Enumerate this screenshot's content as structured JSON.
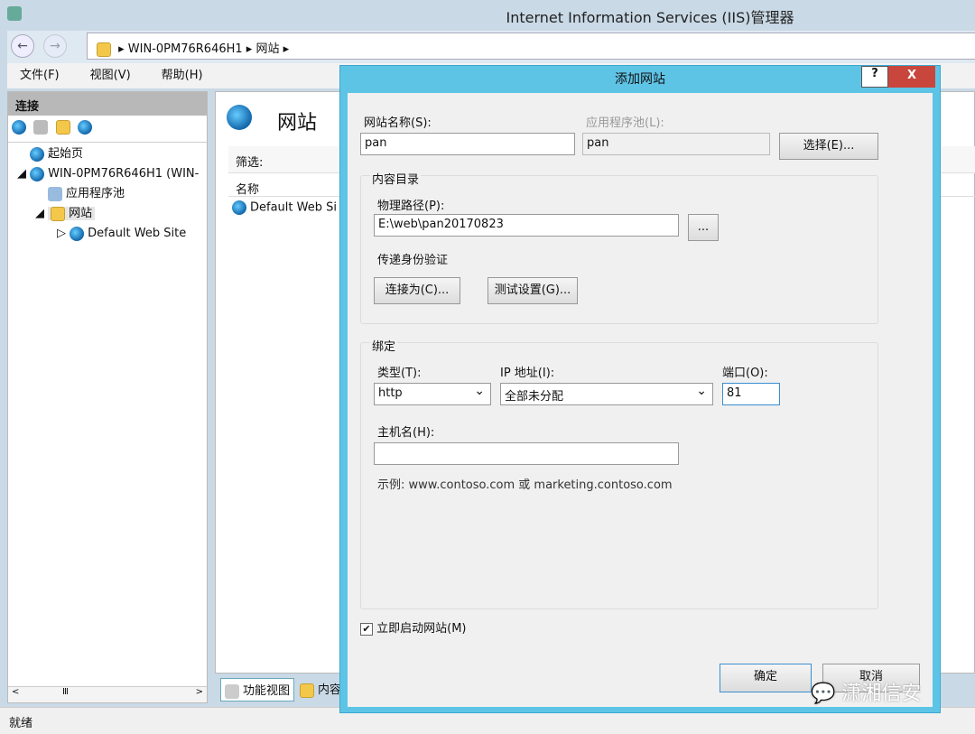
{
  "window": {
    "title": "Internet Information Services (IIS)管理器"
  },
  "address": {
    "crumbs": [
      "WIN-0PM76R646H1",
      "网站"
    ]
  },
  "menu": [
    "文件(F)",
    "视图(V)",
    "帮助(H)"
  ],
  "connections": {
    "header": "连接",
    "tree": [
      "起始页",
      "WIN-0PM76R646H1 (WIN-",
      "应用程序池",
      "网站",
      "Default Web Site"
    ]
  },
  "main": {
    "title": "网站",
    "filter_label": "筛选:",
    "column_name": "名称",
    "rows": [
      "Default Web Si"
    ],
    "tabs": [
      "功能视图",
      "内容"
    ]
  },
  "status": "就绪",
  "dialog": {
    "title": "添加网站",
    "help": "?",
    "close": "X",
    "site_name_label": "网站名称(S):",
    "site_name": "pan",
    "app_pool_label": "应用程序池(L):",
    "app_pool": "pan",
    "select_btn": "选择(E)...",
    "content_group": "内容目录",
    "path_label": "物理路径(P):",
    "path": "E:\\web\\pan20170823",
    "browse_btn": "...",
    "auth_label": "传递身份验证",
    "connect_as_btn": "连接为(C)...",
    "test_btn": "测试设置(G)...",
    "binding_group": "绑定",
    "type_label": "类型(T):",
    "type": "http",
    "ip_label": "IP 地址(I):",
    "ip": "全部未分配",
    "port_label": "端口(O):",
    "port": "81",
    "host_label": "主机名(H):",
    "host": "",
    "example": "示例: www.contoso.com 或 marketing.contoso.com",
    "start_checkbox": "立即启动网站(M)",
    "start_checked": true,
    "ok": "确定",
    "cancel": "取消"
  },
  "watermark": "潇湘信安"
}
